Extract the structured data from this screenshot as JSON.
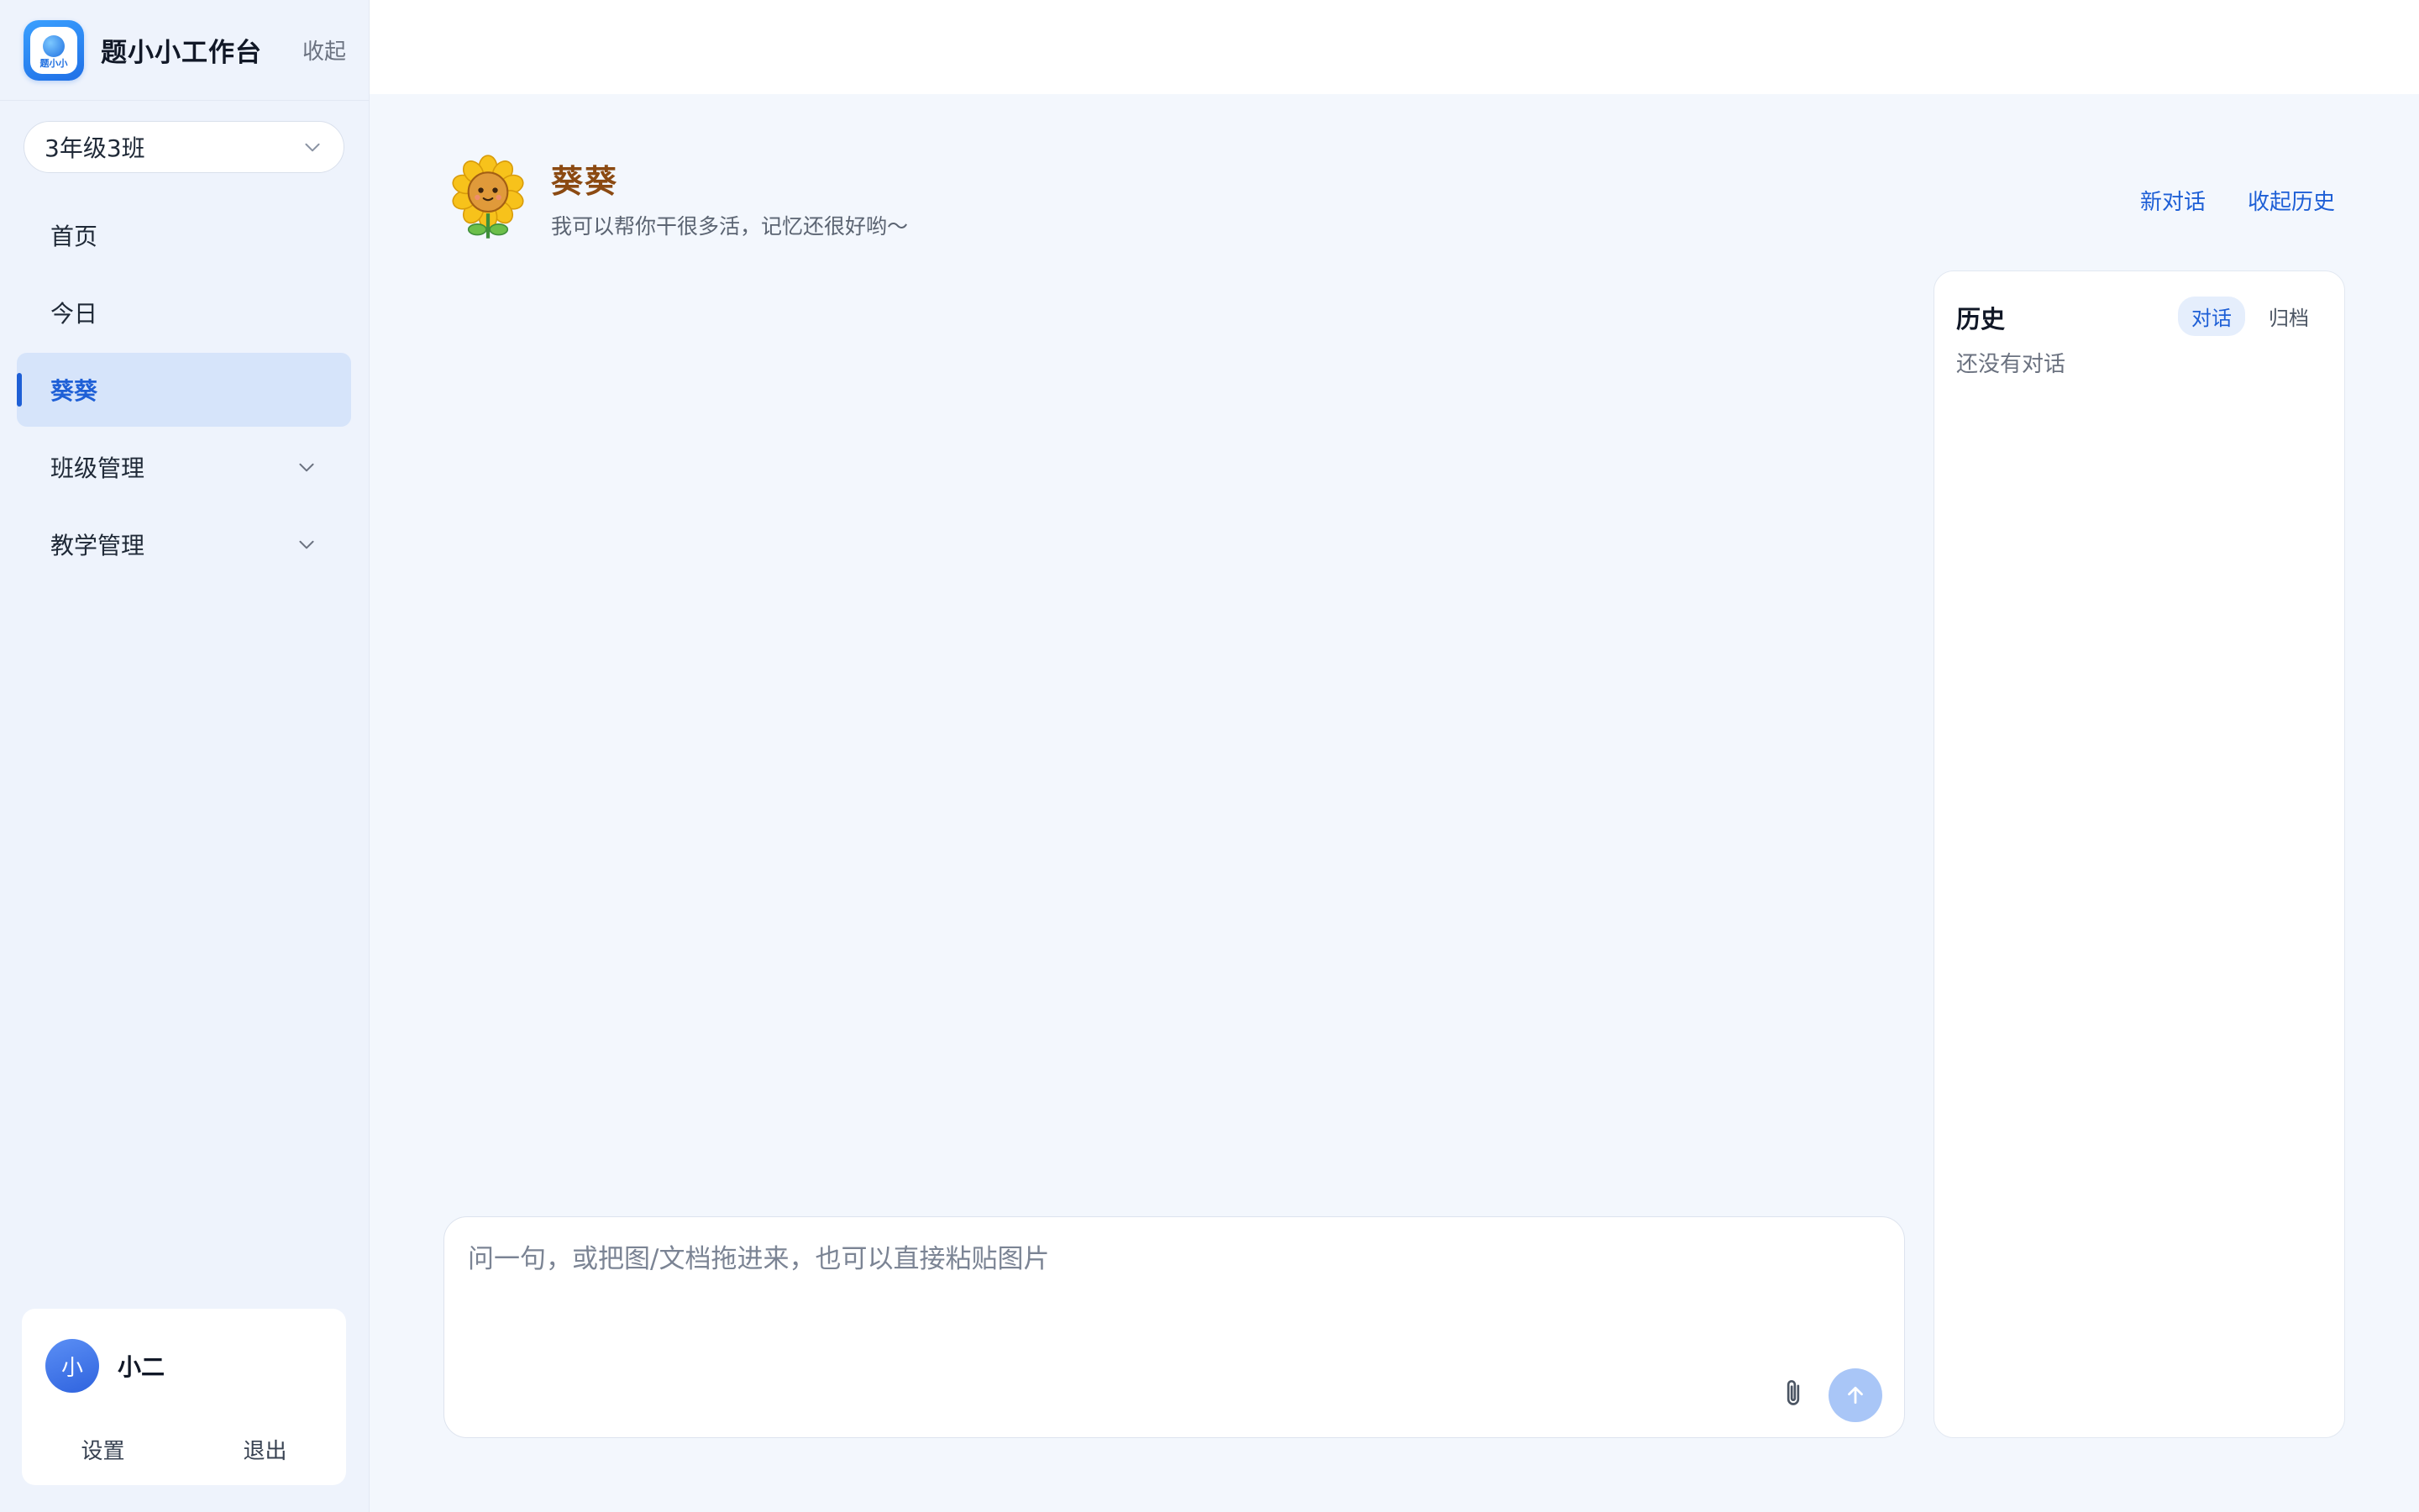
{
  "brand": {
    "logo_text": "题小小",
    "title": "题小小工作台",
    "collapse_label": "收起"
  },
  "class_select": {
    "value": "3年级3班"
  },
  "nav": {
    "items": [
      {
        "label": "首页",
        "active": false,
        "expandable": false
      },
      {
        "label": "今日",
        "active": false,
        "expandable": false
      },
      {
        "label": "葵葵",
        "active": true,
        "expandable": false
      },
      {
        "label": "班级管理",
        "active": false,
        "expandable": true
      },
      {
        "label": "教学管理",
        "active": false,
        "expandable": true
      }
    ]
  },
  "user": {
    "avatar_initial": "小",
    "name": "小二",
    "settings_label": "设置",
    "logout_label": "退出"
  },
  "agent": {
    "name": "葵葵",
    "description": "我可以帮你干很多活，记忆还很好哟～",
    "avatar_icon": "sunflower-mascot"
  },
  "header_actions": {
    "new_chat": "新对话",
    "collapse_history": "收起历史"
  },
  "composer": {
    "value": "",
    "placeholder": "问一句，或把图/文档拖进来，也可以直接粘贴图片"
  },
  "history": {
    "title": "历史",
    "tabs": [
      {
        "label": "对话",
        "active": true
      },
      {
        "label": "归档",
        "active": false
      }
    ],
    "empty_text": "还没有对话"
  },
  "colors": {
    "accent": "#1e5fd6",
    "agent_name": "#8b4a12",
    "send_button": "#a9c6f7",
    "sidebar_bg": "#eef3fc"
  }
}
